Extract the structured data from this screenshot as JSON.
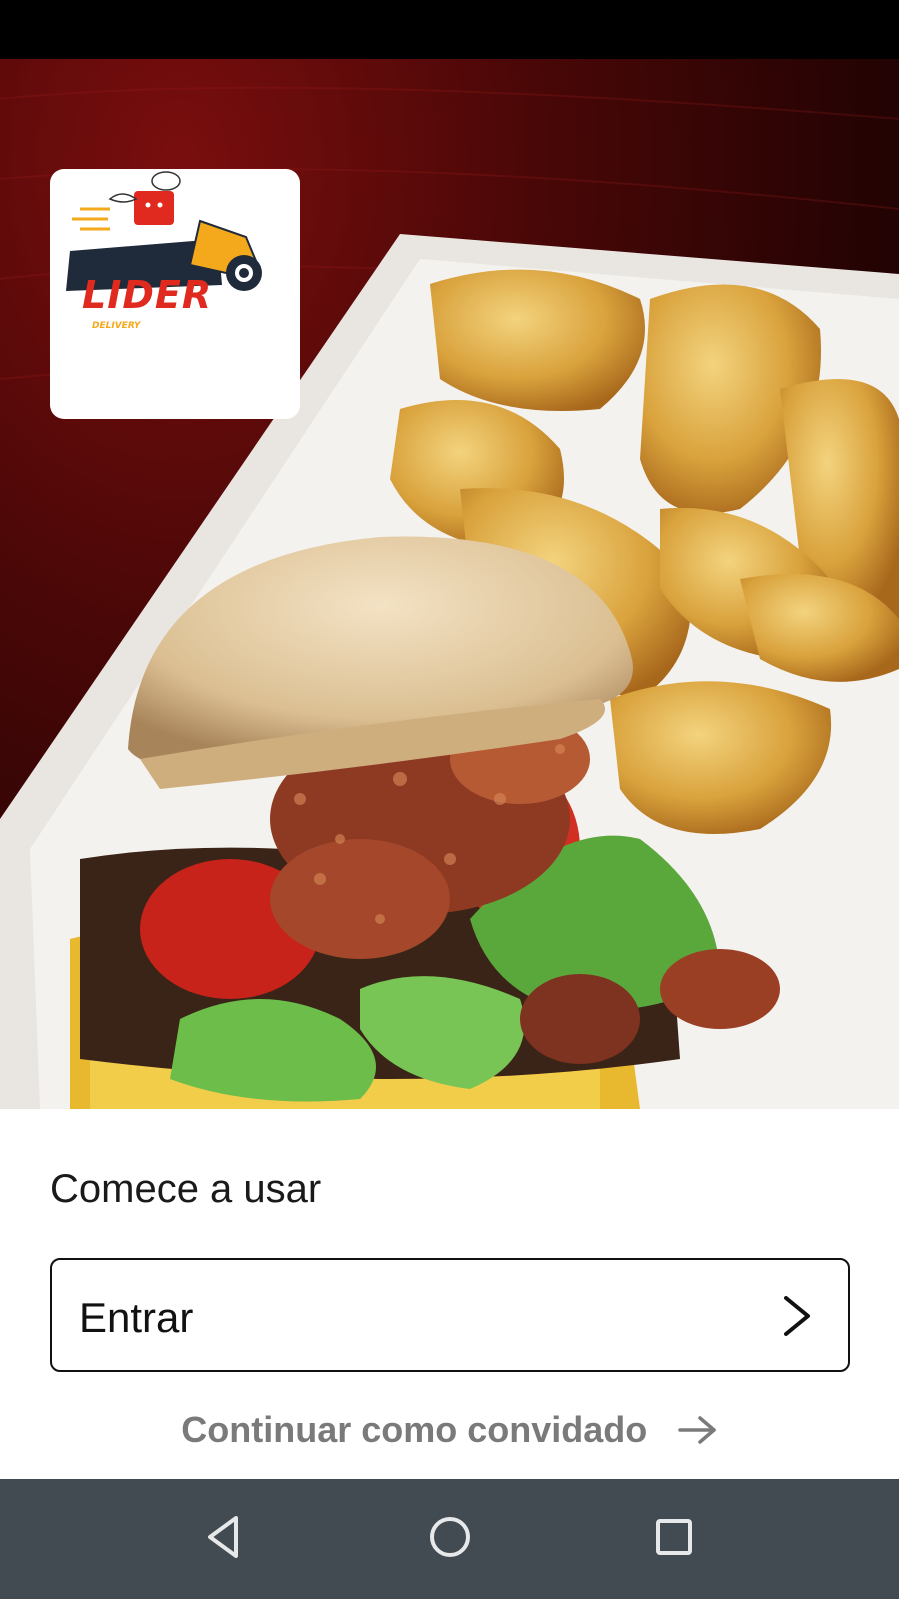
{
  "brand": {
    "logo_text": "LIDER",
    "logo_subtext": "DELIVERY"
  },
  "hero": {
    "image": "burger-and-potato-wedges-photo"
  },
  "sheet": {
    "title": "Comece a usar",
    "login_button": {
      "label": "Entrar",
      "icon": "chevron-right-icon"
    },
    "guest_link": {
      "label": "Continuar como convidado",
      "icon": "arrow-right-icon"
    }
  },
  "nav_bar": {
    "back_icon": "back-triangle-icon",
    "home_icon": "home-circle-icon",
    "recents_icon": "recents-square-icon"
  },
  "colors": {
    "status_bar": "#000000",
    "nav_bar": "#434b52",
    "text_primary": "#111111",
    "text_secondary": "#7a7a7a",
    "logo_red": "#e02a1f",
    "logo_yellow": "#f4a81b"
  }
}
